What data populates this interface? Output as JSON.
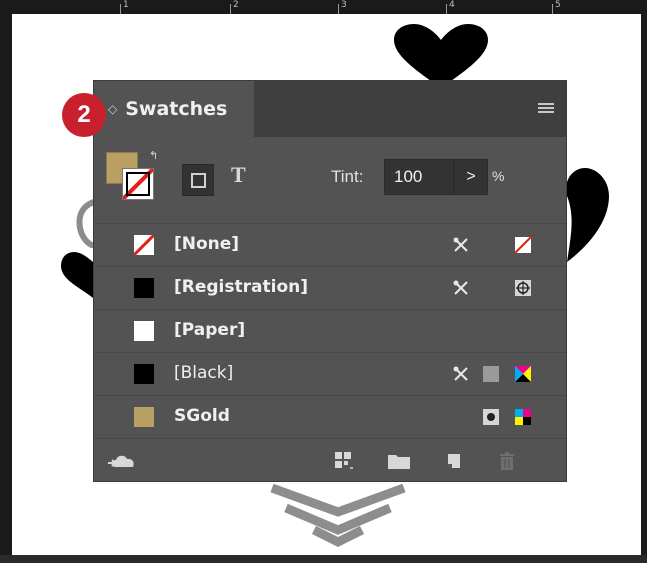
{
  "ruler": {
    "numbers": [
      "1",
      "2",
      "3",
      "4",
      "5"
    ]
  },
  "badge": {
    "number": "2"
  },
  "panel": {
    "tab_title": "Swatches",
    "collapse_glyph": "◇",
    "menu_icon": "panel-menu-icon",
    "text_icon_glyph": "T",
    "tint": {
      "label": "Tint:",
      "value": "100",
      "arrow": ">",
      "unit": "%"
    },
    "swatches": [
      {
        "name": "[None]",
        "chip": "none",
        "icons": [
          "no-edit-icon",
          "none-swatch-icon"
        ]
      },
      {
        "name": "[Registration]",
        "chip": "#000000",
        "icons": [
          "no-edit-icon",
          "registration-icon"
        ]
      },
      {
        "name": "[Paper]",
        "chip": "#ffffff",
        "icons": []
      },
      {
        "name": "[Black]",
        "chip": "#000000",
        "icons": [
          "no-edit-icon",
          "process-color-icon",
          "cmyk-icon"
        ]
      },
      {
        "name": "SGold",
        "chip": "#b99f63",
        "icons": [
          "spot-color-icon",
          "cmyk-icon"
        ]
      }
    ],
    "footer_icons": [
      "cc-libraries-icon",
      "color-group-icon",
      "new-group-folder-icon",
      "new-swatch-icon",
      "trash-icon"
    ]
  },
  "colors": {
    "panel_bg": "#535353",
    "gold": "#b99f63",
    "badge_red": "#c8202d"
  }
}
